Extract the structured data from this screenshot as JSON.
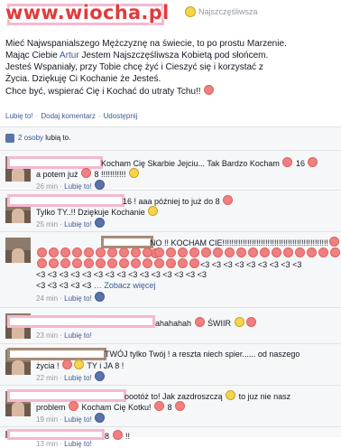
{
  "watermark": "www.wiocha.pl",
  "post": {
    "author": "Najszczęśliwsza",
    "lines": [
      "Mieć Najwspanialszego Mężczyznę na świecie, to po prostu Marzenie.",
      "Mając Ciebie ",
      " Jestem Najszczęśliwsza Kobietą pod słońcem.",
      "Jesteś Wspaniały, przy Tobie chcę żyć i Cieszyć się i korzystać z",
      "Życia. Dziękuję Ci Kochanie że Jesteś.",
      "Chce być, wspierać Cię i Kochać do utraty Tchu!! "
    ],
    "name_link": "Artur",
    "actions": [
      "Lubię to!",
      "Dodaj komentarz",
      "Udostępnij"
    ]
  },
  "likes": {
    "count_link": "2 osoby",
    "suffix": "lubią to."
  },
  "comments": [
    {
      "text_a": "Kocham Cię Skarbie Jejciu... Tak Bardzo Kocham ",
      "text_b": " 16 ",
      "text_c": "a potem już ",
      "text_d": " 8 !!!!!!!!!!! ",
      "time": "26 min",
      "like": "Lubię to!"
    },
    {
      "text_a": "16 ! aaa później to już do 8 ",
      "text_b": "Tylko TY..!! Dziękuje Kochanie ",
      "time": "25 min",
      "like": "Lubię to!"
    },
    {
      "text_a": "NO !! KOCHAM CIE!!!!!!!!!!!!!!!!!!!!!!!!!!!!!!!!!!!!!!!!!!!!!!!",
      "text_b": "<3 <3 <3 <3 <3 <3 <3 <3 <3",
      "text_c": "<3 <3 <3 <3 <3 <3 <3 <3 <3 <3 <3 <3 <3 <3 <3",
      "text_d": "<3 <3 <3 <3 <3 ",
      "more": "Zobacz więcej",
      "time": "24 min",
      "like": "Lubię to!"
    },
    {
      "text_a": "ahahahah ",
      "text_b": " ŚWIIR ",
      "time": "23 min",
      "like": "Lubię to!"
    },
    {
      "text_a": "TWÓJ tylko Twój ! a reszta niech spier...... od naszego",
      "text_b": "życia ! ",
      "text_c": " TY i JA 8 !",
      "time": "22 min",
      "like": "Lubię to!"
    },
    {
      "text_a": "oootóż to! Jak zazdroszczą ",
      "text_b": " to juz nie nasz",
      "text_c": "problem ",
      "text_d": " Kocham Cię Kotku! ",
      "text_e": " 8 ",
      "time": "19 min",
      "like": "Lubię to!"
    },
    {
      "text_a": "8 ",
      "text_b": " !!",
      "time": "13 min",
      "like": "Lubię to!"
    }
  ]
}
